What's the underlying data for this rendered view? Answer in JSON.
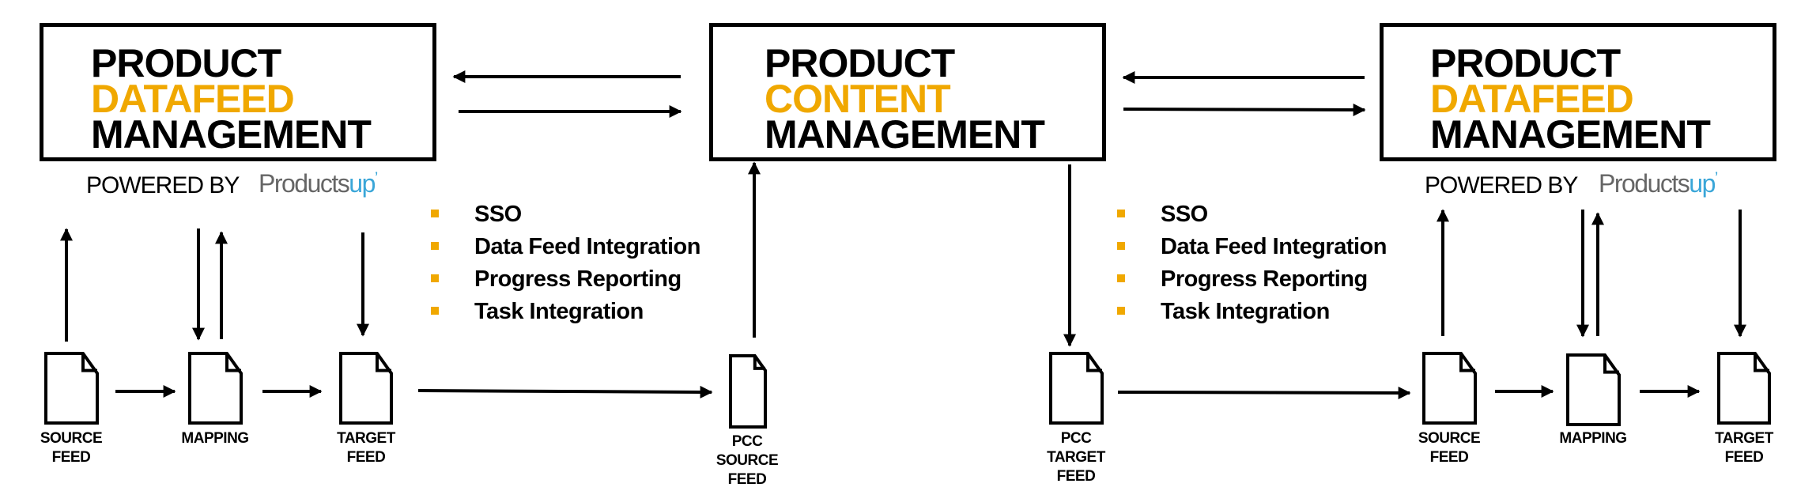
{
  "colors": {
    "accent": "#f0a800",
    "logo_blue": "#3aa6d8",
    "logo_gray": "#666666",
    "text": "#000000"
  },
  "left_box": {
    "line1": "PRODUCT",
    "line2": "DATAFEED",
    "line3": "MANAGEMENT"
  },
  "center_box": {
    "line1": "PRODUCT",
    "line2": "CONTENT",
    "line3": "MANAGEMENT"
  },
  "right_box": {
    "line1": "PRODUCT",
    "line2": "DATAFEED",
    "line3": "MANAGEMENT"
  },
  "powered_by": {
    "label": "POWERED BY",
    "logo_main": "Products",
    "logo_accent": "up",
    "logo_mark": "’"
  },
  "features_left": [
    "SSO",
    "Data Feed Integration",
    "Progress Reporting",
    "Task Integration"
  ],
  "features_right": [
    "SSO",
    "Data Feed Integration",
    "Progress Reporting",
    "Task Integration"
  ],
  "documents": {
    "left_source": [
      "SOURCE",
      "FEED"
    ],
    "left_mapping": [
      "MAPPING"
    ],
    "left_target": [
      "TARGET",
      "FEED"
    ],
    "pcc_source": [
      "PCC",
      "SOURCE",
      "FEED"
    ],
    "pcc_target": [
      "PCC",
      "TARGET",
      "FEED"
    ],
    "right_source": [
      "SOURCE",
      "FEED"
    ],
    "right_mapping": [
      "MAPPING"
    ],
    "right_target": [
      "TARGET",
      "FEED"
    ]
  }
}
